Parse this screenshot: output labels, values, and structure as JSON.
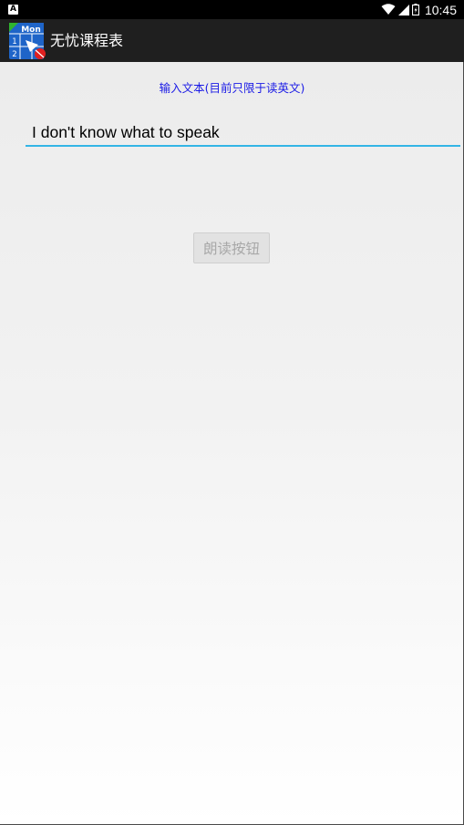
{
  "status_bar": {
    "notification_icon": "A",
    "time": "10:45",
    "icons": [
      "wifi-icon",
      "signal-icon",
      "battery-icon"
    ]
  },
  "action_bar": {
    "logo_text": "Mon",
    "logo_numbers": [
      "1",
      "2"
    ],
    "title": "无忧课程表"
  },
  "main": {
    "prompt": "输入文本(目前只限于读英文)",
    "text_input_value": "I don't know what to speak",
    "read_button_label": "朗读按钮"
  },
  "colors": {
    "prompt_text": "#1a1ae6",
    "input_underline": "#33b5e5",
    "action_bar": "#1f1f1f"
  }
}
